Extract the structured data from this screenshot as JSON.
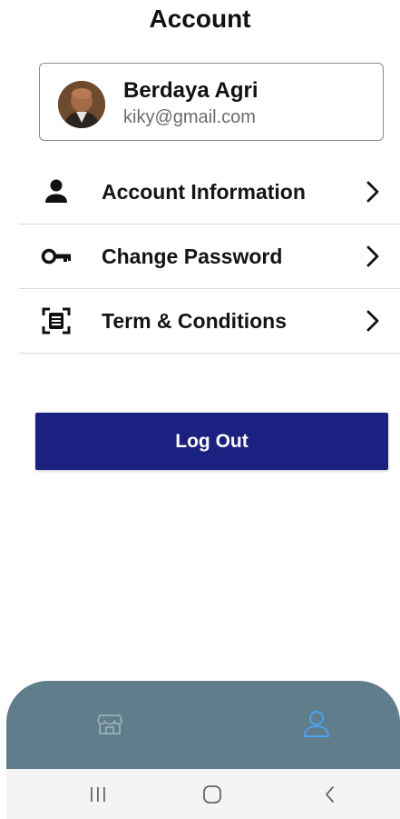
{
  "header": {
    "title": "Account"
  },
  "profile": {
    "name": "Berdaya Agri",
    "email": "kiky@gmail.com"
  },
  "menu": [
    {
      "label": "Account Information",
      "icon": "person-icon"
    },
    {
      "label": "Change Password",
      "icon": "key-icon"
    },
    {
      "label": "Term & Conditions",
      "icon": "document-scan-icon"
    }
  ],
  "logout": {
    "label": "Log Out"
  },
  "colors": {
    "logout_bg": "#1b2180",
    "bottom_nav_bg": "#607d8b",
    "active_tab": "#4aa3f0",
    "inactive_tab": "#9aaeb8"
  },
  "bottom_nav": [
    {
      "icon": "store-icon",
      "active": false
    },
    {
      "icon": "person-outline-icon",
      "active": true
    }
  ],
  "system_nav": [
    {
      "icon": "recent-apps-icon"
    },
    {
      "icon": "home-icon"
    },
    {
      "icon": "back-icon"
    }
  ]
}
